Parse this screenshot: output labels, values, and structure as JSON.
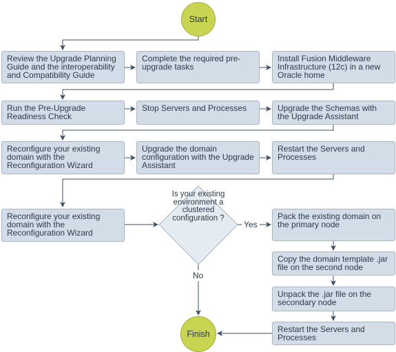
{
  "diagram": {
    "start": "Start",
    "finish": "Finish",
    "steps": [
      "Review the Upgrade Planning Guide and the interoperability and Compatibility Guide",
      "Complete the required pre-upgrade tasks",
      "Install Fusion Middleware Infrastructure (12c) in a new Oracle home",
      "Run the Pre-Upgrade Readiness Check",
      "Stop Servers and Processes",
      "Upgrade the Schemas with the Upgrade Assistant",
      "Reconfigure your existing domain with the Reconfiguration Wizard",
      "Upgrade the domain configuration with the Upgrade Assistant",
      "Restart the Servers and Processes",
      "Reconfigure your existing domain with the Reconfiguration Wizard"
    ],
    "decision": "Is your existing environment a clustered configuration ?",
    "yes_label": "Yes",
    "no_label": "No",
    "cluster_steps": [
      "Pack the existing domain on the primary node",
      "Copy the domain template .jar file on the second node",
      "Unpack the .jar file on the secondary node",
      "Restart the Servers and Processes"
    ],
    "colors": {
      "terminal_fill": "#c9d552",
      "process_fill": "#d3dde7",
      "decision_fill": "#e4ebf1",
      "connector": "#3d4f60"
    }
  }
}
